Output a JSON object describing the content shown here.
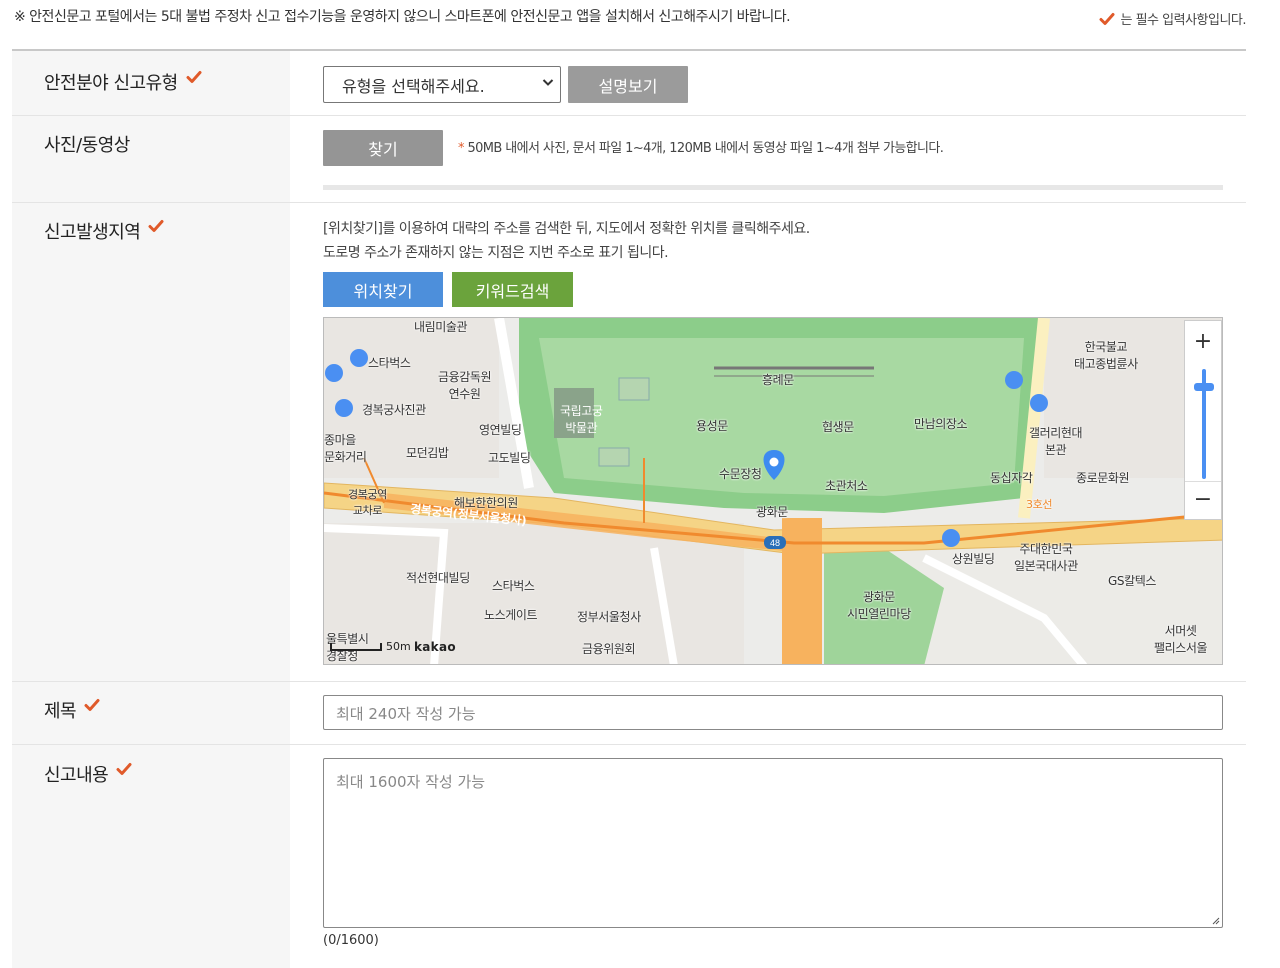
{
  "notice": "※ 안전신문고 포털에서는 5대 불법 주정차 신고 접수기능을 운영하지 않으니 스마트폰에 안전신문고 앱을 설치해서 신고해주시기 바랍니다.",
  "required_note": "는 필수 입력사항입니다.",
  "colors": {
    "check": "#e05a2a",
    "blue_button": "#4d8fdb",
    "green_button": "#6ba33c",
    "gray_button": "#9b9b9b"
  },
  "report_type": {
    "label": "안전분야 신고유형",
    "select_value": "유형을 선택해주세요.",
    "desc_button": "설명보기"
  },
  "media": {
    "label": "사진/동영상",
    "find_button": "찾기",
    "note_star": "*",
    "note": "50MB 내에서 사진, 문서 파일 1~4개, 120MB 내에서 동영상 파일 1~4개 첨부 가능합니다."
  },
  "location": {
    "label": "신고발생지역",
    "guide_line1": "[위치찾기]를 이용하여 대략의 주소를 검색한 뒤, 지도에서 정확한 위치를 클릭해주세요.",
    "guide_line2": "도로명 주소가 존재하지 않는 지점은 지번 주소로 표기 됩니다.",
    "find_location_button": "위치찾기",
    "keyword_search_button": "키워드검색",
    "map": {
      "zoom_in": "+",
      "zoom_out": "−",
      "scale": "50m",
      "brand": "kakao",
      "labels": {
        "a": "내림미술관",
        "b": "스타벅스",
        "c": "금융감독원\n연수원",
        "d": "경복궁사진관",
        "e": "영연빌딩",
        "f": "모던김밥",
        "g": "고도빌딩",
        "h": "국립고궁\n박물관",
        "i": "흥례문",
        "j": "용성문",
        "k": "협생문",
        "l": "만남의장소",
        "m": "수문장청",
        "n": "초관처소",
        "o": "광화문",
        "p": "한국불교\n태고종법륜사",
        "q": "갤러리현대\n본관",
        "r": "동십자각",
        "s": "종로문화원",
        "t": "경복궁역\n교차로",
        "u": "해보한한의원",
        "v": "경복궁역(정부서울청사)",
        "w": "3호선",
        "x": "적선현대빌딩",
        "y": "스타벅스",
        "z": "노스게이트",
        "aa": "정부서울청사",
        "ab": "금융위원회",
        "ac": "광화문\n시민열린마당",
        "ad": "상원빌딩",
        "ae": "주대한민국\n일본국대사관",
        "af": "GS칼텍스",
        "ag": "서머셋\n팰리스서울",
        "ah": "울특별시\n경찰청",
        "ai": "종마을\n문화거리",
        "aj": "48"
      }
    }
  },
  "title": {
    "label": "제목",
    "placeholder": "최대 240자 작성 가능"
  },
  "content": {
    "label": "신고내용",
    "placeholder": "최대 1600자 작성 가능",
    "counter": "(0/1600)"
  }
}
